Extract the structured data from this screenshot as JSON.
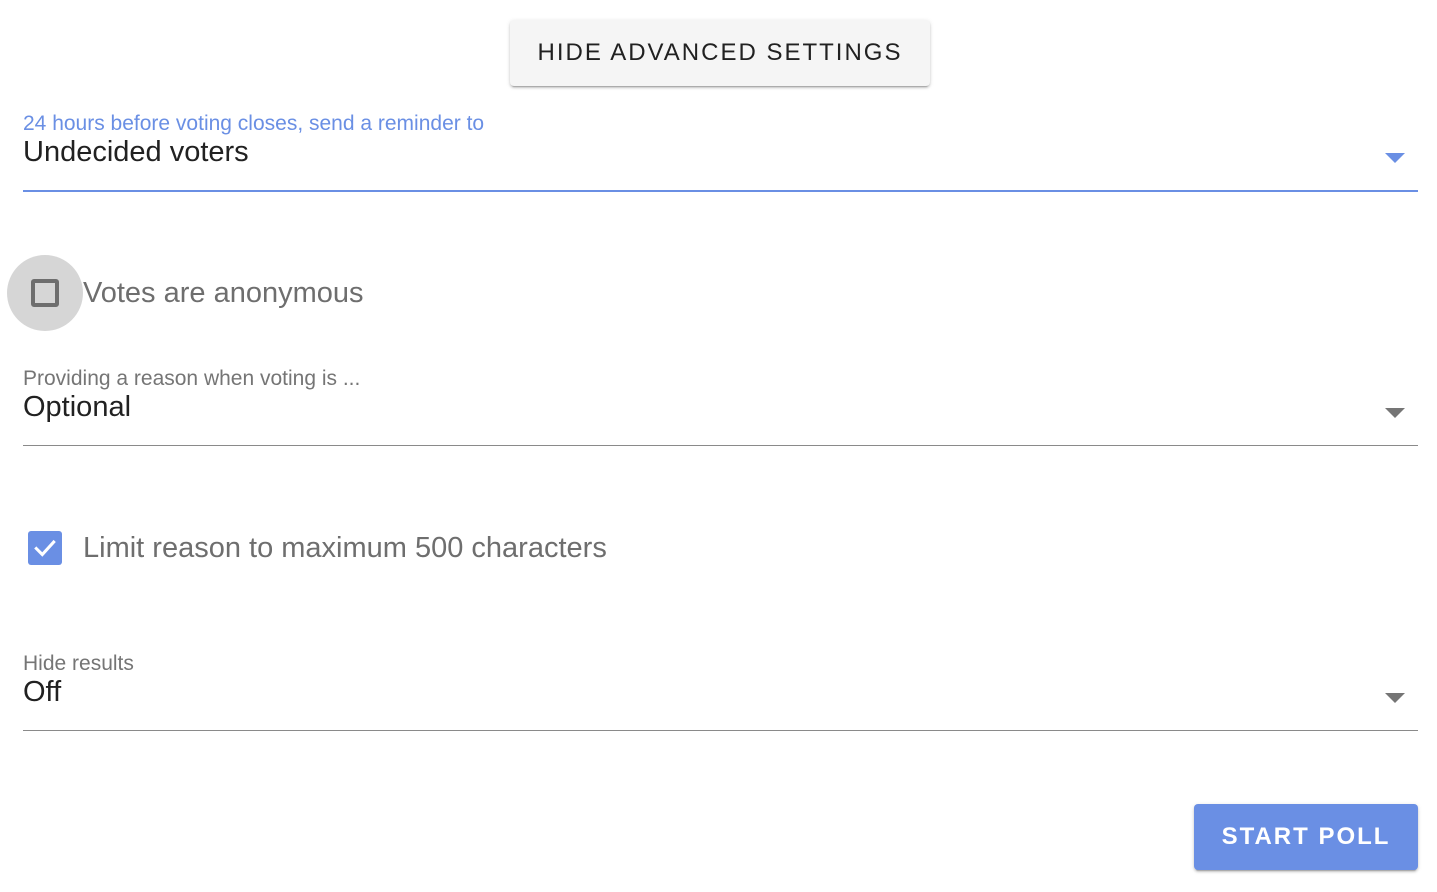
{
  "advanced_toggle": {
    "label": "HIDE ADVANCED SETTINGS"
  },
  "reminder": {
    "label": "24 hours before voting closes, send a reminder to",
    "value": "Undecided voters"
  },
  "anonymous": {
    "label": "Votes are anonymous",
    "checked": false
  },
  "reason": {
    "label": "Providing a reason when voting is ...",
    "value": "Optional"
  },
  "limit_reason": {
    "label": "Limit reason to maximum 500 characters",
    "checked": true
  },
  "hide_results": {
    "label": "Hide results",
    "value": "Off"
  },
  "start_poll": {
    "label": "START POLL"
  },
  "colors": {
    "accent": "#6a8fe4",
    "text_primary": "#212121",
    "text_secondary": "#757575"
  }
}
